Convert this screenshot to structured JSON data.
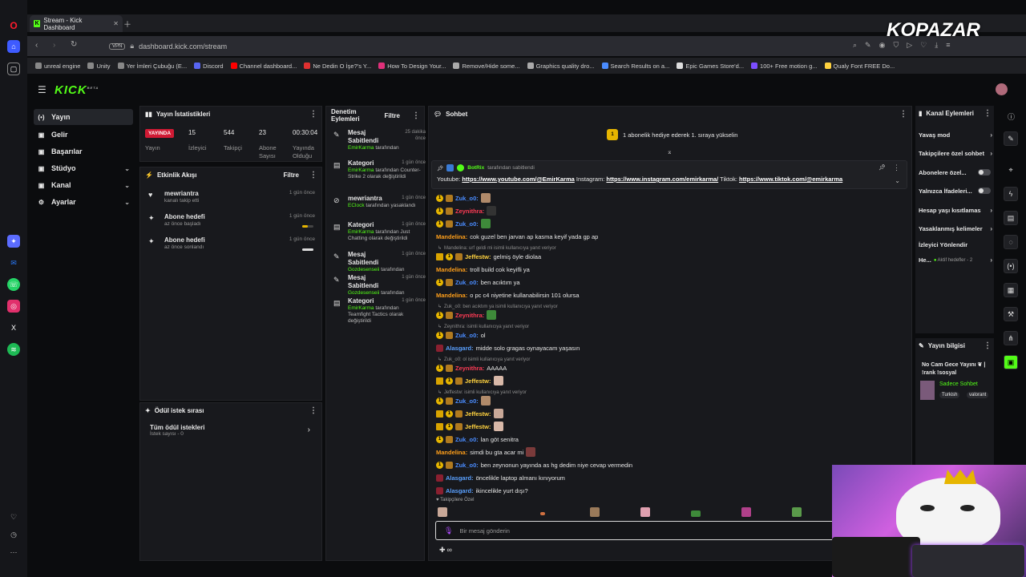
{
  "browser": {
    "tab_title": "Stream - Kick Dashboard",
    "url": "dashboard.kick.com/stream",
    "vpn_label": "VPN",
    "bookmarks": [
      {
        "label": "unreal engine",
        "color": "#888"
      },
      {
        "label": "Unity",
        "color": "#888"
      },
      {
        "label": "Yer İmleri Çubuğu (E...",
        "color": "#888"
      },
      {
        "label": "Discord",
        "color": "#5865f2"
      },
      {
        "label": "Channel dashboard...",
        "color": "#ff0000"
      },
      {
        "label": "Ne Dedin O İşe?'s Y...",
        "color": "#e03030"
      },
      {
        "label": "How To Design Your...",
        "color": "#e0307a"
      },
      {
        "label": "Remove/Hide some...",
        "color": "#aaa"
      },
      {
        "label": "Graphics quality dro...",
        "color": "#aaa"
      },
      {
        "label": "Search Results on a...",
        "color": "#4a8cff"
      },
      {
        "label": "Epic Games Store'd...",
        "color": "#ddd"
      },
      {
        "label": "100+ Free motion g...",
        "color": "#7b4dff"
      },
      {
        "label": "Qualy Font FREE Do...",
        "color": "#ffd23f"
      }
    ]
  },
  "watermark": "KOPAZAR",
  "brand": {
    "logo": "KICK",
    "beta": "BETA",
    "accent": "#53fc18"
  },
  "nav": [
    {
      "label": "Yayın",
      "icon": "(•)"
    },
    {
      "label": "Gelir",
      "icon": "▣"
    },
    {
      "label": "Başarılar",
      "icon": "▣"
    },
    {
      "label": "Stüdyo",
      "icon": "▣"
    },
    {
      "label": "Kanal",
      "icon": "▣"
    },
    {
      "label": "Ayarlar",
      "icon": "⚙"
    }
  ],
  "stats": {
    "title": "Yayın İstatistikleri",
    "live_badge": "YAYINDA",
    "viewers": "15",
    "followers": "544",
    "subs": "23",
    "uptime": "00:30:04",
    "labels": {
      "stream": "Yayın",
      "viewers": "İzleyici",
      "followers": "Takipçi",
      "subs": "Abone Sayısı",
      "uptime": "Yayında Olduğu Süre"
    }
  },
  "activity": {
    "title": "Etkinlik Akışı",
    "filter": "Filtre",
    "items": [
      {
        "title": "mewriantra",
        "sub": "kanalı takip etti",
        "date": "1 gün önce",
        "icon": "♥"
      },
      {
        "title": "Abone hedefi",
        "sub": "az önce başladı",
        "date": "1 gün önce",
        "icon": "✦"
      },
      {
        "title": "Abone hedefi",
        "sub": "az önce sonlandı",
        "date": "1 gün önce",
        "icon": "✦"
      }
    ]
  },
  "rewards": {
    "title": "Ödül istek sırası",
    "all": "Tüm ödül istekleri",
    "count": "İstek sayısı - 0"
  },
  "moderation": {
    "title": "Denetim Eylemleri",
    "filter": "Filtre",
    "items": [
      {
        "title": "Mesaj Sabitlendi",
        "date": "25 dakika önce",
        "by": "EmirKarma",
        "rest": " tarafından",
        "icon": "✎"
      },
      {
        "title": "Kategori",
        "date": "1 gün önce",
        "by": "EmirKarma",
        "rest": " tarafından Counter-Strike 2 olarak değiştirildi",
        "icon": "▤"
      },
      {
        "title": "mewriantra",
        "date": "1 gün önce",
        "by": "EClock",
        "rest": " tarafından yasaklandı",
        "icon": "⊘"
      },
      {
        "title": "Kategori",
        "date": "1 gün önce",
        "by": "EmirKarma",
        "rest": " tarafından Just Chatting olarak değiştirildi",
        "icon": "▤"
      },
      {
        "title": "Mesaj Sabitlendi",
        "date": "1 gün önce",
        "by": "Gozdesenseii",
        "rest": " tarafından",
        "icon": "✎"
      },
      {
        "title": "Mesaj Sabitlendi",
        "date": "1 gün önce",
        "by": "Gozdesenseii",
        "rest": " tarafından",
        "icon": "✎"
      },
      {
        "title": "Kategori",
        "date": "1 gün önce",
        "by": "EmirKarma",
        "rest": " tarafından Teamfight Tactics olarak değiştirildi",
        "icon": "▤"
      }
    ]
  },
  "chat": {
    "title": "Sohbet",
    "gift_banner": "1 abonelik hediye ederek 1. sıraya yükselin",
    "pinned_by": "BotRix",
    "pinned_suffix": "tarafından sabitlendi",
    "pinned_prefix": "Youtube: ",
    "pinned_yt": "https://www.youtube.com/@EmirKarma",
    "pinned_ig_label": " Instagram: ",
    "pinned_ig": "https://www.instagram.com/emirkarma/",
    "pinned_tt_label": " Tiktok: ",
    "pinned_tt": "https://www.tiktok.com/@emirkarma",
    "messages": [
      {
        "user": "Zuk_o0",
        "cls": "u-blue",
        "text": "",
        "emote": "#b08a6a",
        "badges": "1s"
      },
      {
        "user": "Zeynithra",
        "cls": "u-red",
        "text": "",
        "emote": "#333",
        "badges": "1s"
      },
      {
        "user": "Zuk_o0",
        "cls": "u-blue",
        "text": "",
        "emote": "#3e8a3a",
        "badges": "1s"
      },
      {
        "user": "Mandelina",
        "cls": "u-orange",
        "text": "cok guzel ben jarvan ap kasma keyif yada gp ap",
        "badges": ""
      },
      {
        "user": "Jeffestw",
        "cls": "u-yellow",
        "text": "gelmiş öyle diolaa",
        "badges": "c1s",
        "reply": "Mandelina: urf geldi mi isimli kullanıcıya yanıt veriyor"
      },
      {
        "user": "Mandelina",
        "cls": "u-orange",
        "text": "troll build cok keyifli ya",
        "badges": ""
      },
      {
        "user": "Zuk_o0",
        "cls": "u-blue",
        "text": "ben acıktım ya",
        "badges": "1s"
      },
      {
        "user": "Mandelina",
        "cls": "u-orange",
        "text": "o pc c4 niyetine kullanabilirsin 101 olursa",
        "badges": ""
      },
      {
        "user": "Zeynithra",
        "cls": "u-red",
        "text": "",
        "emote": "#3e8a3a",
        "badges": "1s",
        "reply": "Zuk_o0: ben acıktım ya isimli kullanıcıya yanıt veriyor"
      },
      {
        "user": "Zuk_o0",
        "cls": "u-blue",
        "text": "ol",
        "badges": "1s",
        "reply": "Zeynithra:  isimli kullanıcıya yanıt veriyor"
      },
      {
        "user": "Alasgard",
        "cls": "u-lb",
        "text": "midde solo gragas oynayacam yaşasın",
        "badges": "r"
      },
      {
        "user": "Zeynithra",
        "cls": "u-red",
        "text": "AAAAA",
        "badges": "1s",
        "reply": "Zuk_o0: ol isimli kullanıcıya yanıt veriyor"
      },
      {
        "user": "Jeffestw",
        "cls": "u-yellow",
        "text": "",
        "emote": "#d8b8a8",
        "badges": "c1s"
      },
      {
        "user": "Zuk_o0",
        "cls": "u-blue",
        "text": "",
        "emote": "#b08a6a",
        "badges": "1s",
        "reply": "Jeffestw:  isimli kullanıcıya yanıt veriyor"
      },
      {
        "user": "Jeffestw",
        "cls": "u-yellow",
        "text": "",
        "emote": "#c8a898",
        "badges": "c1s"
      },
      {
        "user": "Jeffestw",
        "cls": "u-yellow",
        "text": "",
        "emote": "#d8b8a8",
        "badges": "c1s"
      },
      {
        "user": "Zuk_o0",
        "cls": "u-blue",
        "text": "lan göt senitra",
        "badges": "1s"
      },
      {
        "user": "Mandelina",
        "cls": "u-orange",
        "text": "simdi bu gta acar mi",
        "emote": "#7a3a3a",
        "badges": ""
      },
      {
        "user": "Zuk_o0",
        "cls": "u-blue",
        "text": "ben zeynonun yayında as hg dedim niye cevap vermedin",
        "badges": "1s"
      },
      {
        "user": "Alasgard",
        "cls": "u-lb",
        "text": "öncelikle laptop almanı kınıyorum",
        "badges": "r"
      },
      {
        "user": "Alasgard",
        "cls": "u-lb",
        "text": "ikincelikle yurt dışı?",
        "badges": "r"
      }
    ],
    "followers_only_label": "Takipçilere Özel",
    "input_placeholder": "Bir mesaj gönderin"
  },
  "channel_actions": {
    "title": "Kanal Eylemleri",
    "items": [
      {
        "label": "Yavaş mod",
        "ctrl": "chev"
      },
      {
        "label": "Takipçilere özel sohbet",
        "ctrl": "chev"
      },
      {
        "label": "Abonelere özel...",
        "ctrl": "toggle"
      },
      {
        "label": "Yalnızca İfadeleri...",
        "ctrl": "toggle"
      },
      {
        "label": "Hesap yaşı kısıtlamas",
        "ctrl": "chev"
      },
      {
        "label": "Yasaklanmış kelimeler",
        "ctrl": "chev"
      },
      {
        "label": "İzleyici Yönlendir",
        "ctrl": ""
      }
    ],
    "goals_label": "He...",
    "goals_active": "Aktif hedefler - 2"
  },
  "stream_info": {
    "title": "Yayın bilgisi",
    "stream_title": "No Cam Gece Yayını ❦ | !rank !sosyal",
    "mode": "Sadece Sohbet",
    "tags": [
      "Turkish",
      "valorant"
    ]
  }
}
